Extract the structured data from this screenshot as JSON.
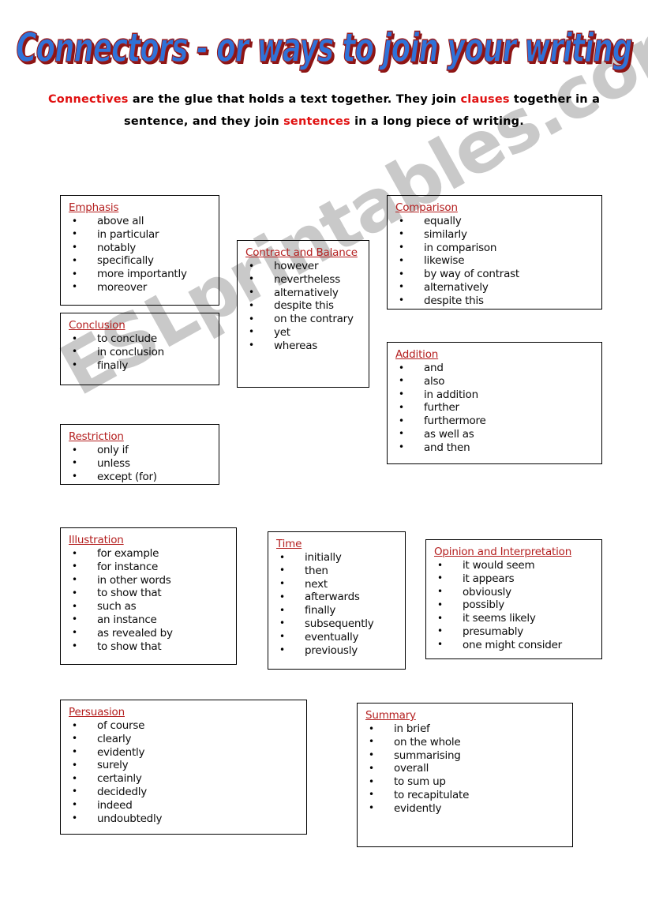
{
  "title": "Connectors  -  or ways to join your writing",
  "subtitle": {
    "seg1": "Connectives",
    "seg2": " are the glue that holds a text together.  They join ",
    "seg3": "clauses",
    "seg4": " together in a sentence, and they join ",
    "seg5": "sentences",
    "seg6": " in a long piece of writing."
  },
  "watermark": "ESLprintables.com",
  "colors": {
    "heading": "#b41f1f",
    "highlight": "#e01010",
    "title_fill": "#2f72d8",
    "title_shadow": "#8d1515",
    "watermark": "#c9c9c9"
  },
  "boxes": [
    {
      "id": "emphasis",
      "heading": "Emphasis",
      "items": [
        "above all",
        "in particular",
        "notably",
        "specifically",
        "more importantly",
        "moreover"
      ]
    },
    {
      "id": "conclusion",
      "heading": "Conclusion",
      "items": [
        "to conclude",
        "in conclusion",
        "finally"
      ]
    },
    {
      "id": "restriction",
      "heading": "Restriction",
      "items": [
        "only if",
        "unless",
        "except (for)"
      ]
    },
    {
      "id": "contract-and-balance",
      "heading": "Contract and Balance",
      "items": [
        "however",
        "nevertheless",
        "alternatively",
        "despite this",
        "on the contrary",
        "yet",
        "whereas"
      ]
    },
    {
      "id": "comparison",
      "heading": "Comparison",
      "items": [
        "equally",
        "similarly",
        "in comparison",
        "likewise",
        "by way of contrast",
        "alternatively",
        "despite this"
      ]
    },
    {
      "id": "addition",
      "heading": "Addition",
      "items": [
        "and",
        "also",
        "in addition",
        "further",
        "furthermore",
        "as well as",
        "and then"
      ]
    },
    {
      "id": "illustration",
      "heading": "Illustration",
      "items": [
        "for example",
        "for instance",
        "in other words",
        "to show that",
        "such as",
        "an instance",
        "as revealed by",
        "to show that"
      ]
    },
    {
      "id": "time",
      "heading": "Time",
      "items": [
        "initially",
        "then",
        "next",
        "afterwards",
        "finally",
        "subsequently",
        "eventually",
        "previously"
      ]
    },
    {
      "id": "opinion-and-interpretation",
      "heading": "Opinion and Interpretation",
      "items": [
        "it would seem",
        "it appears",
        "obviously",
        "possibly",
        "it seems likely",
        "presumably",
        "one might consider"
      ]
    },
    {
      "id": "persuasion",
      "heading": "Persuasion",
      "items": [
        "of course",
        "clearly",
        "evidently",
        "surely",
        "certainly",
        "decidedly",
        "indeed",
        "undoubtedly"
      ]
    },
    {
      "id": "summary",
      "heading": "Summary",
      "items": [
        "in brief",
        "on the whole",
        "summarising",
        "overall",
        "to sum up",
        "to recapitulate",
        "evidently"
      ]
    }
  ]
}
